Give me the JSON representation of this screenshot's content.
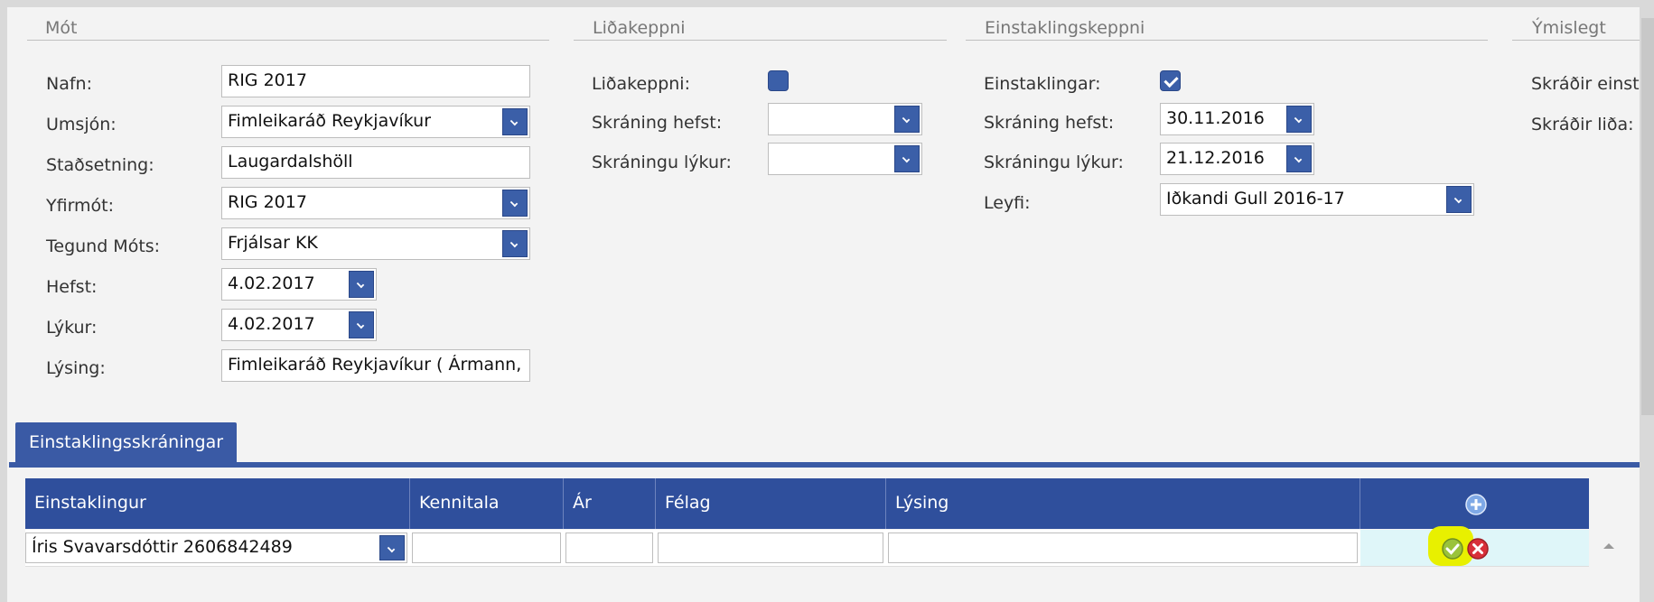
{
  "sections": {
    "mot": "Mót",
    "lidakeppni": "Liðakeppni",
    "einstaklingskeppni": "Einstaklingskeppni",
    "ymislegt": "Ýmislegt"
  },
  "mot": {
    "nafn_label": "Nafn:",
    "nafn_value": "RIG 2017",
    "umsjon_label": "Umsjón:",
    "umsjon_value": "Fimleikaráð Reykjavíkur",
    "stadsetning_label": "Staðsetning:",
    "stadsetning_value": "Laugardalshöll",
    "yfirmot_label": "Yfirmót:",
    "yfirmot_value": "RIG 2017",
    "tegund_label": "Tegund Móts:",
    "tegund_value": "Frjálsar KK",
    "hefst_label": "Hefst:",
    "hefst_value": "4.02.2017",
    "lykur_label": "Lýkur:",
    "lykur_value": "4.02.2017",
    "lysing_label": "Lýsing:",
    "lysing_value": "Fimleikaráð Reykjavíkur ( Ármann, Fjölnir"
  },
  "lid": {
    "lidakeppni_label": "Liðakeppni:",
    "lidakeppni_checked": false,
    "skraning_hefst_label": "Skráning hefst:",
    "skraning_hefst_value": "",
    "skraningu_lykur_label": "Skráningu lýkur:",
    "skraningu_lykur_value": ""
  },
  "einst": {
    "einstaklingar_label": "Einstaklingar:",
    "einstaklingar_checked": true,
    "skraning_hefst_label": "Skráning hefst:",
    "skraning_hefst_value": "30.11.2016",
    "skraningu_lykur_label": "Skráningu lýkur:",
    "skraningu_lykur_value": "21.12.2016",
    "leyfi_label": "Leyfi:",
    "leyfi_value": "Iðkandi Gull 2016-17"
  },
  "ymislegt": {
    "skradir_einst_label": "Skráðir einsta",
    "skradir_lida_label": "Skráðir liða:"
  },
  "tab": {
    "label": "Einstaklingsskráningar"
  },
  "grid": {
    "columns": [
      "Einstaklingur",
      "Kennitala",
      "Ár",
      "Félag",
      "Lýsing"
    ],
    "row": {
      "einstaklingur": "Íris Svavarsdóttir 2606842489",
      "kennitala": "",
      "ar": "",
      "felag": "",
      "lysing": ""
    }
  },
  "icons": {
    "add": "add-circle-icon",
    "confirm": "confirm-check-icon",
    "cancel": "cancel-x-icon",
    "highlight_color": "#e8f000"
  }
}
